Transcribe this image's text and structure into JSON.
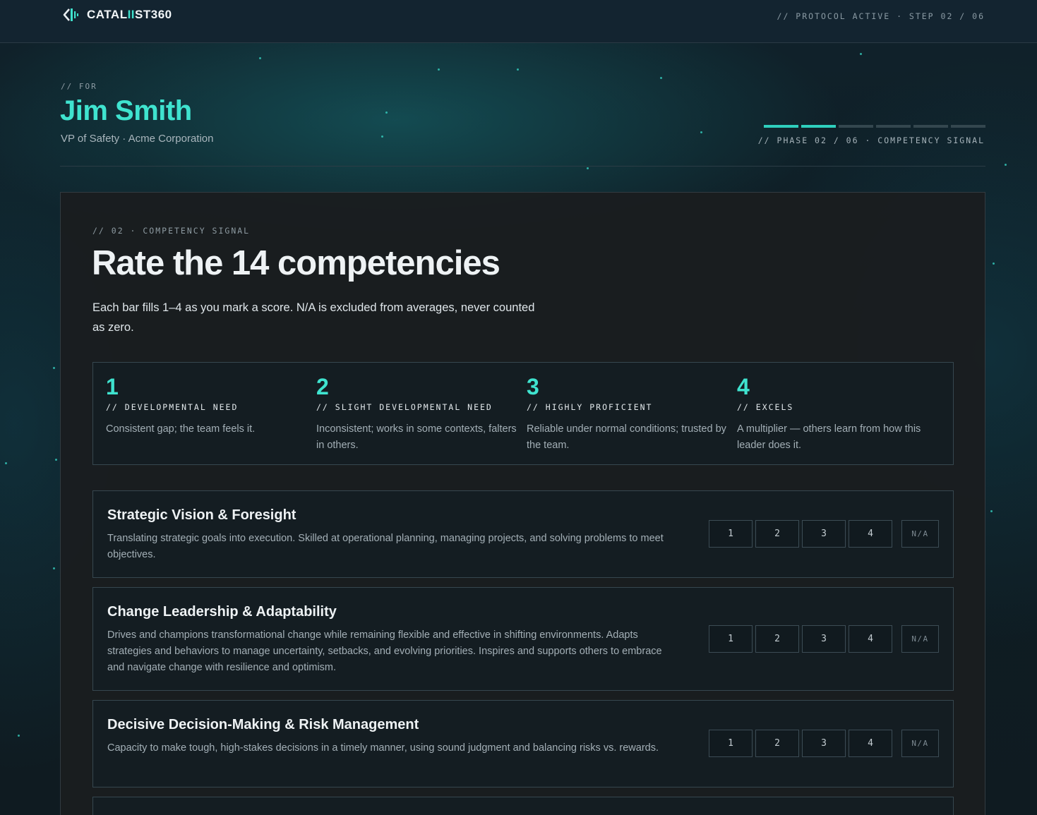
{
  "brand": {
    "name_pre": "CATAL",
    "name_accent": "II",
    "name_post": "ST360"
  },
  "topbar": {
    "protocol": "// PROTOCOL ACTIVE · STEP 02 / 06"
  },
  "header": {
    "for_label": "// FOR",
    "name": "Jim Smith",
    "role": "VP of Safety · Acme Corporation",
    "phase_label": "// PHASE 02 / 06 · COMPETENCY SIGNAL",
    "progress": {
      "current": 2,
      "total": 6
    }
  },
  "section": {
    "label": "// 02 · COMPETENCY SIGNAL",
    "title": "Rate the 14 competencies",
    "intro": "Each bar fills 1–4 as you mark a score. N/A is excluded from averages, never counted as zero."
  },
  "scale": [
    {
      "num": "1",
      "name": "// DEVELOPMENTAL NEED",
      "desc": "Consistent gap; the team feels it."
    },
    {
      "num": "2",
      "name": "// SLIGHT DEVELOPMENTAL NEED",
      "desc": "Inconsistent; works in some contexts, falters in others."
    },
    {
      "num": "3",
      "name": "// HIGHLY PROFICIENT",
      "desc": "Reliable under normal conditions; trusted by the team."
    },
    {
      "num": "4",
      "name": "// EXCELS",
      "desc": "A multiplier — others learn from how this leader does it."
    }
  ],
  "rating_options": [
    "1",
    "2",
    "3",
    "4",
    "N/A"
  ],
  "competencies": [
    {
      "title": "Strategic Vision & Foresight",
      "desc": "Translating strategic goals into execution. Skilled at operational planning, managing projects, and solving problems to meet objectives."
    },
    {
      "title": "Change Leadership & Adaptability",
      "desc": "Drives and champions transformational change while remaining flexible and effective in shifting environments. Adapts strategies and behaviors to manage uncertainty, setbacks, and evolving priorities. Inspires and supports others to embrace and navigate change with resilience and optimism."
    },
    {
      "title": "Decisive Decision-Making & Risk Management",
      "desc": "Capacity to make tough, high-stakes decisions in a timely manner, using sound judgment and balancing risks vs. rewards."
    }
  ]
}
